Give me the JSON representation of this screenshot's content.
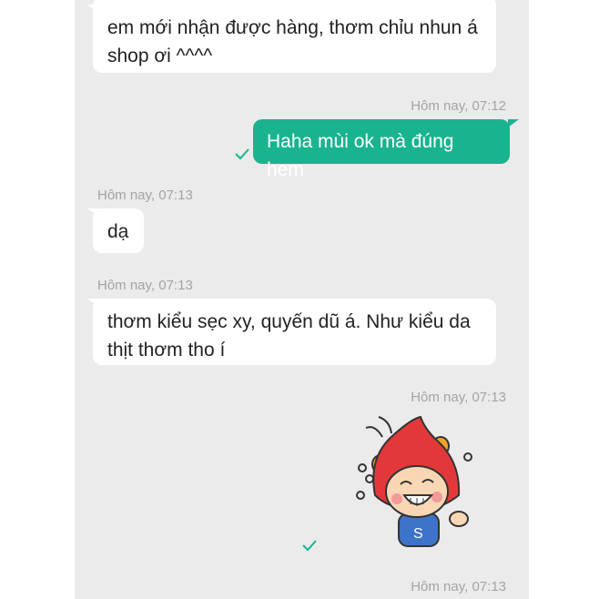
{
  "messages": [
    {
      "text_line1": "em mới nhận được hàng, thơm chỉu nhun á",
      "text_line2": "shop ơi ^^^^"
    },
    {
      "timestamp": "Hôm nay, 07:12",
      "text": "Haha mùi ok mà đúng hem"
    },
    {
      "timestamp": "Hôm nay, 07:13",
      "text": "dạ"
    },
    {
      "timestamp": "Hôm nay, 07:13",
      "text_line1": "thơm kiểu sẹc xy, quyến dũ á. Như kiểu da",
      "text_line2": "thịt thơm tho í"
    },
    {
      "timestamp": "Hôm nay, 07:13",
      "sticker_badge": "S"
    },
    {
      "timestamp": "Hôm nay, 07:13"
    }
  ],
  "colors": {
    "chat_background": "#ebebeb",
    "outgoing_bubble": "#19b48f",
    "incoming_bubble": "#ffffff",
    "timestamp_text": "#a4a4a4",
    "sent_check": "#19b48f"
  },
  "icons": [
    "check-icon",
    "sticker-character"
  ]
}
